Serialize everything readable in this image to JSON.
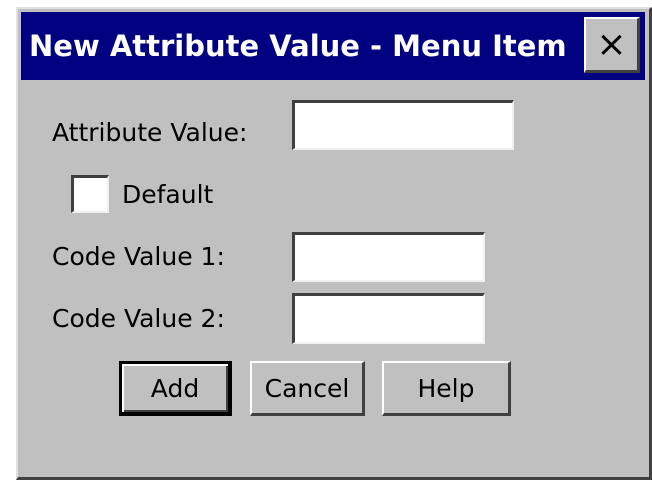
{
  "window": {
    "title": "New Attribute Value - Menu Item",
    "close_symbol": "×",
    "close_icon": "close-icon"
  },
  "form": {
    "attribute_value_label": "Attribute Value:",
    "attribute_value": "",
    "default_label": "Default",
    "default_checked": false,
    "code_value_1_label": "Code Value 1:",
    "code_value_1": "",
    "code_value_2_label": "Code Value 2:",
    "code_value_2": ""
  },
  "buttons": {
    "add": "Add",
    "cancel": "Cancel",
    "help": "Help"
  },
  "colors": {
    "titlebar": "#000080",
    "dialog_background": "#c0c0c0",
    "field_background": "#ffffff"
  }
}
